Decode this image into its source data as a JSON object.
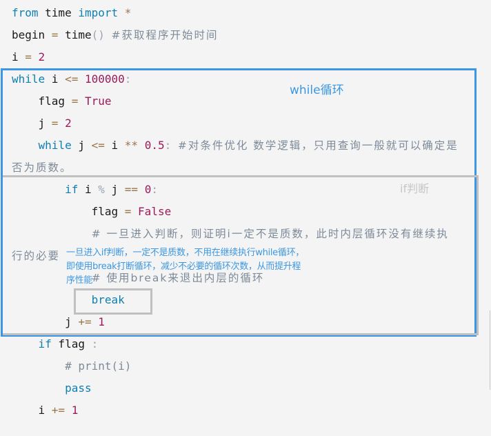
{
  "code": {
    "lines": [
      {
        "tokens": [
          {
            "t": "from",
            "c": "kw"
          },
          {
            "t": " time ",
            "c": ""
          },
          {
            "t": "import",
            "c": "kw"
          },
          {
            "t": " *",
            "c": "op"
          }
        ]
      },
      {
        "tokens": [
          {
            "t": "begin ",
            "c": ""
          },
          {
            "t": "=",
            "c": "op"
          },
          {
            "t": " time",
            "c": ""
          },
          {
            "t": "()",
            "c": "punc"
          },
          {
            "t": " ",
            "c": ""
          },
          {
            "t": "#获取程序开始时间",
            "c": "cjk-cmt"
          }
        ]
      },
      {
        "tokens": [
          {
            "t": "i ",
            "c": ""
          },
          {
            "t": "=",
            "c": "op"
          },
          {
            "t": " ",
            "c": ""
          },
          {
            "t": "2",
            "c": "num"
          }
        ]
      },
      {
        "tokens": [
          {
            "t": "while",
            "c": "kw"
          },
          {
            "t": " i ",
            "c": ""
          },
          {
            "t": "<=",
            "c": "op"
          },
          {
            "t": " ",
            "c": ""
          },
          {
            "t": "100000",
            "c": "num"
          },
          {
            "t": ":",
            "c": "punc"
          }
        ]
      },
      {
        "tokens": [
          {
            "t": "    flag ",
            "c": ""
          },
          {
            "t": "=",
            "c": "op"
          },
          {
            "t": " ",
            "c": ""
          },
          {
            "t": "True",
            "c": "const"
          }
        ]
      },
      {
        "tokens": [
          {
            "t": "    j ",
            "c": ""
          },
          {
            "t": "=",
            "c": "op"
          },
          {
            "t": " ",
            "c": ""
          },
          {
            "t": "2",
            "c": "num"
          }
        ]
      },
      {
        "tokens": [
          {
            "t": "    ",
            "c": ""
          },
          {
            "t": "while",
            "c": "kw"
          },
          {
            "t": " j ",
            "c": ""
          },
          {
            "t": "<=",
            "c": "op"
          },
          {
            "t": " i ",
            "c": ""
          },
          {
            "t": "**",
            "c": "op"
          },
          {
            "t": " ",
            "c": ""
          },
          {
            "t": "0.5",
            "c": "num"
          },
          {
            "t": ":",
            "c": "punc"
          },
          {
            "t": " ",
            "c": ""
          },
          {
            "t": "#对条件优化 数学逻辑，只用查询一般就可以确定是",
            "c": "cjk-cmt"
          }
        ]
      },
      {
        "tokens": [
          {
            "t": "否为质数。",
            "c": "cjk-cmt"
          }
        ]
      },
      {
        "tokens": [
          {
            "t": "        ",
            "c": ""
          },
          {
            "t": "if",
            "c": "kw"
          },
          {
            "t": " i ",
            "c": ""
          },
          {
            "t": "%",
            "c": "punc"
          },
          {
            "t": " j ",
            "c": ""
          },
          {
            "t": "==",
            "c": "op"
          },
          {
            "t": " ",
            "c": ""
          },
          {
            "t": "0",
            "c": "num"
          },
          {
            "t": ":",
            "c": "punc"
          }
        ]
      },
      {
        "tokens": [
          {
            "t": "            flag ",
            "c": ""
          },
          {
            "t": "=",
            "c": "op"
          },
          {
            "t": " ",
            "c": ""
          },
          {
            "t": "False",
            "c": "const"
          }
        ]
      },
      {
        "tokens": [
          {
            "t": "            ",
            "c": ""
          },
          {
            "t": "# 一旦进入判断，则证明i一定不是质数，此时内层循环没有继续执",
            "c": "cjk-cmt"
          }
        ]
      },
      {
        "tokens": [
          {
            "t": "行的必要",
            "c": "cjk-cmt"
          }
        ]
      },
      {
        "tokens": [
          {
            "t": "            ",
            "c": ""
          },
          {
            "t": "# 使用break来退出内层的循环",
            "c": "cjk-cmt"
          }
        ]
      },
      {
        "tokens": [
          {
            "t": "            ",
            "c": ""
          },
          {
            "t": "break",
            "c": "kw"
          }
        ]
      },
      {
        "tokens": [
          {
            "t": "        j ",
            "c": ""
          },
          {
            "t": "+=",
            "c": "op"
          },
          {
            "t": " ",
            "c": ""
          },
          {
            "t": "1",
            "c": "num"
          }
        ]
      },
      {
        "tokens": [
          {
            "t": "    ",
            "c": ""
          },
          {
            "t": "if",
            "c": "kw"
          },
          {
            "t": " flag ",
            "c": ""
          },
          {
            "t": ":",
            "c": "punc"
          }
        ]
      },
      {
        "tokens": [
          {
            "t": "        ",
            "c": ""
          },
          {
            "t": "# print(i)",
            "c": "cmt"
          }
        ]
      },
      {
        "tokens": [
          {
            "t": "        ",
            "c": ""
          },
          {
            "t": "pass",
            "c": "kw"
          }
        ]
      },
      {
        "tokens": [
          {
            "t": "    i ",
            "c": ""
          },
          {
            "t": "+=",
            "c": "op"
          },
          {
            "t": " ",
            "c": ""
          },
          {
            "t": "1",
            "c": "num"
          }
        ]
      }
    ]
  },
  "annotations": {
    "while_label": "while循环",
    "if_label": "if判断",
    "break_note": [
      "一旦进入if判断，一定不是质数，不用在继续执行while循环，",
      "即使用break打断循环，减少不必要的循环次数，从而提升程",
      "序性能"
    ]
  },
  "colors": {
    "while_box": "#3b97e3",
    "if_box": "#c0c0c0",
    "break_box": "#c0c0c0",
    "background": "#f4f4f4"
  }
}
